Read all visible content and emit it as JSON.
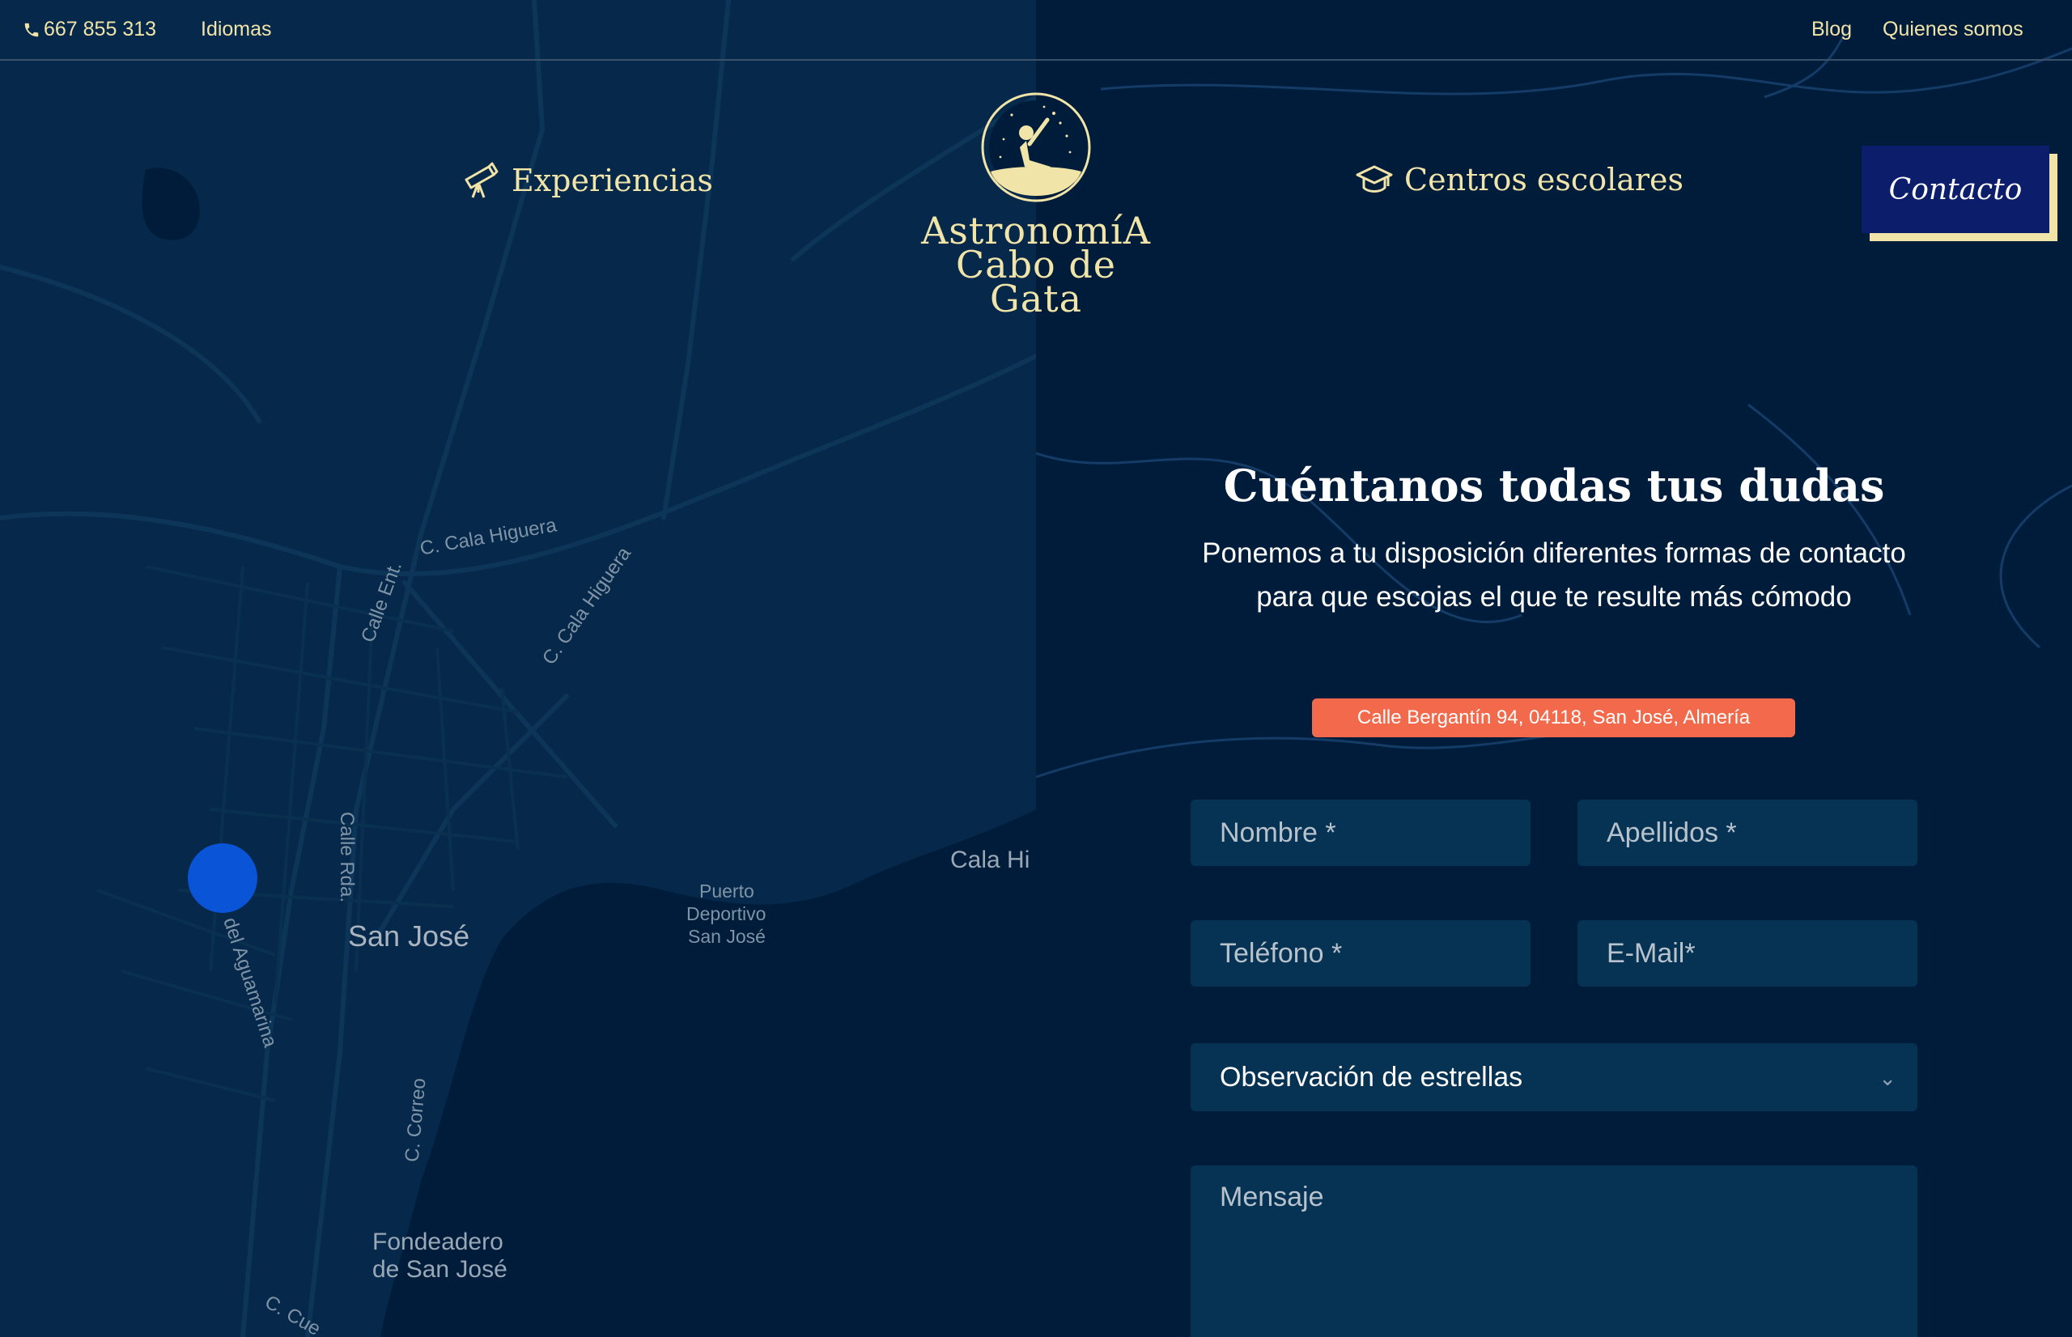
{
  "topbar": {
    "phone_icon": "phone-icon",
    "phone": "667 855 313",
    "languages": "Idiomas",
    "blog": "Blog",
    "about": "Quienes somos"
  },
  "nav": {
    "experiences": {
      "icon": "telescope-icon",
      "label": "Experiencias"
    },
    "schools": {
      "icon": "graduation-cap-icon",
      "label": "Centros escolares"
    },
    "contact": "Contacto"
  },
  "logo": {
    "line1": "AstronomíA",
    "line2": "Cabo de Gata"
  },
  "map": {
    "labels": [
      "C. Cala Higuera",
      "C. Cala Higuera",
      "Calle Ent.",
      "Calle Rda.",
      "del Aguamarina",
      "San José",
      "Puerto",
      "Deportivo",
      "San José",
      "Cala Hi",
      "C. Correo",
      "Fondeadero",
      "de San José",
      "C. Cue"
    ]
  },
  "contact": {
    "title": "Cuéntanos todas tus dudas",
    "subtitle": "Ponemos a tu disposición diferentes formas de contacto para que escojas el que te resulte más cómodo",
    "address": "Calle Bergantín 94, 04118, San José, Almería"
  },
  "form": {
    "nombre_placeholder": "Nombre *",
    "apellidos_placeholder": "Apellidos *",
    "telefono_placeholder": "Teléfono *",
    "email_placeholder": "E-Mail*",
    "select_value": "Observación de estrellas",
    "select_icon": "chevron-down-icon",
    "mensaje_placeholder": "Mensaje"
  },
  "colors": {
    "background": "#001c3b",
    "map": "#06284a",
    "accent": "#f1e4a8",
    "address_badge": "#f26a4b",
    "field": "#063353",
    "contact_button": "#0b1d6b"
  }
}
